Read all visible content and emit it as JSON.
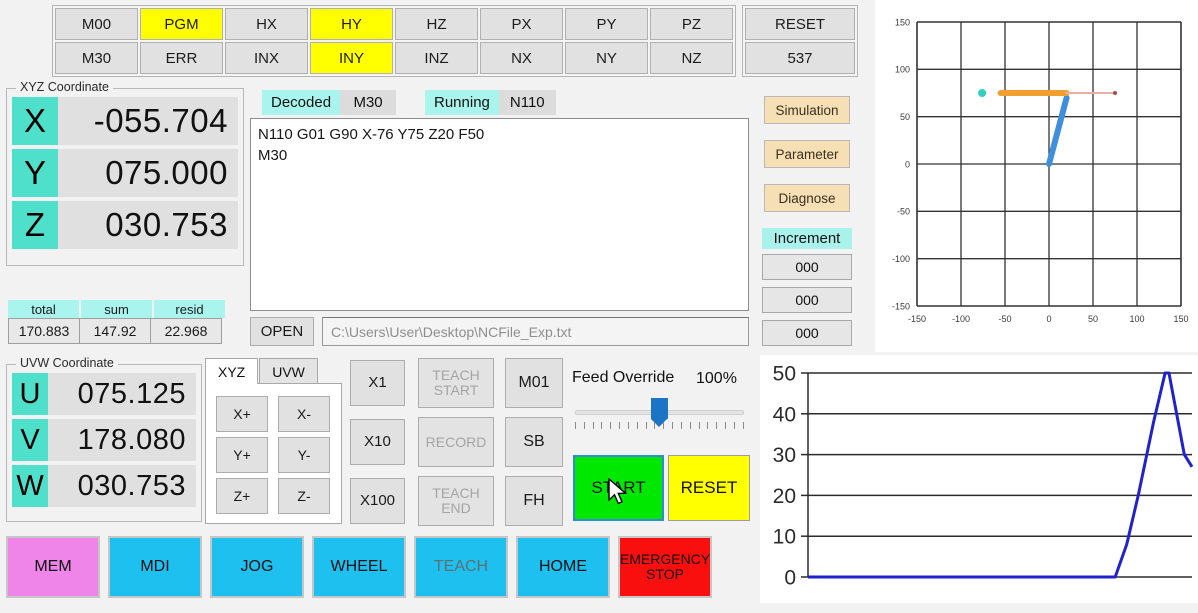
{
  "status_grid": {
    "row1": [
      "M00",
      "PGM",
      "HX",
      "HY",
      "HZ",
      "PX",
      "PY",
      "PZ"
    ],
    "row2": [
      "M30",
      "ERR",
      "INX",
      "INY",
      "INZ",
      "NX",
      "NY",
      "NZ"
    ],
    "active": [
      "PGM",
      "HY",
      "INY"
    ],
    "reset_label": "RESET",
    "counter": "537",
    "active_color": "#ffff00"
  },
  "xyz_panel": {
    "title": "XYZ Coordinate",
    "axes": [
      {
        "letter": "X",
        "value": "-055.704"
      },
      {
        "letter": "Y",
        "value": "075.000"
      },
      {
        "letter": "Z",
        "value": "030.753"
      }
    ],
    "letter_bg": "#4fe0cb"
  },
  "uvw_panel": {
    "title": "UVW Coordinate",
    "axes": [
      {
        "letter": "U",
        "value": "075.125"
      },
      {
        "letter": "V",
        "value": "178.080"
      },
      {
        "letter": "W",
        "value": "030.753"
      }
    ]
  },
  "totals": {
    "headers": [
      "total",
      "sum",
      "resid"
    ],
    "values": [
      "170.883",
      "147.92",
      "22.968"
    ]
  },
  "program": {
    "decoded_label": "Decoded",
    "decoded_value": "M30",
    "running_label": "Running",
    "running_value": "N110",
    "gcode": "N110 G01 G90 X-76 Y75 Z20 F50\nM30",
    "open_label": "OPEN",
    "file_path": "C:\\Users\\User\\Desktop\\NCFile_Exp.txt"
  },
  "side_actions": {
    "buttons": [
      "Simulation",
      "Parameter",
      "Diagnose"
    ],
    "increment_label": "Increment",
    "increment_values": [
      "000",
      "000",
      "000"
    ]
  },
  "jog": {
    "tabs": [
      "XYZ",
      "UVW"
    ],
    "active_tab": "XYZ",
    "buttons": [
      "X+",
      "X-",
      "Y+",
      "Y-",
      "Z+",
      "Z-"
    ]
  },
  "step_buttons": [
    "X1",
    "X10",
    "X100"
  ],
  "teach_buttons": [
    {
      "label": "TEACH\nSTART",
      "enabled": false
    },
    {
      "label": "RECORD",
      "enabled": false
    },
    {
      "label": "TEACH\nEND",
      "enabled": false
    }
  ],
  "aux_buttons": [
    "M01",
    "SB",
    "FH"
  ],
  "feed_override": {
    "label": "Feed Override",
    "percent": "100%",
    "slider_position": 50,
    "start_label": "START",
    "reset_label": "RESET",
    "start_color": "#00e800",
    "reset_color": "#ffff00"
  },
  "mode_bar": [
    {
      "label": "MEM",
      "style": "mem"
    },
    {
      "label": "MDI",
      "style": "cyan"
    },
    {
      "label": "JOG",
      "style": "cyan"
    },
    {
      "label": "WHEEL",
      "style": "cyan"
    },
    {
      "label": "TEACH",
      "style": "cyan-dim"
    },
    {
      "label": "HOME",
      "style": "cyan"
    },
    {
      "label": "EMERGENCY\nSTOP",
      "style": "red"
    }
  ],
  "chart_data": [
    {
      "type": "line",
      "name": "xy-toolpath-plot",
      "title": "",
      "xlabel": "",
      "ylabel": "",
      "xlim": [
        -150,
        150
      ],
      "ylim": [
        -150,
        150
      ],
      "xticks": [
        -150,
        -100,
        -50,
        0,
        50,
        100,
        150
      ],
      "yticks": [
        -150,
        -100,
        -50,
        0,
        50,
        100,
        150
      ],
      "grid": true,
      "series": [
        {
          "name": "completed-path-blue",
          "color": "#3f8fdd",
          "width": 6,
          "points": [
            [
              0,
              0
            ],
            [
              20,
              70
            ]
          ]
        },
        {
          "name": "current-path-orange",
          "color": "#f0a030",
          "width": 6,
          "points": [
            [
              20,
              75
            ],
            [
              -55,
              75
            ]
          ]
        },
        {
          "name": "pending-path-faded",
          "color": "#e8b0a8",
          "width": 2,
          "points": [
            [
              20,
              75
            ],
            [
              75,
              75
            ]
          ]
        }
      ],
      "markers": [
        {
          "name": "target-point",
          "color": "#2fd0c0",
          "x": -76,
          "y": 75,
          "size": 4
        },
        {
          "name": "endpoint-marker",
          "color": "#a05040",
          "x": 75,
          "y": 75,
          "size": 2
        }
      ]
    },
    {
      "type": "line",
      "name": "feed-rate-plot",
      "title": "",
      "xlabel": "",
      "ylabel": "",
      "xlim": [
        0,
        100
      ],
      "ylim": [
        0,
        50
      ],
      "yticks": [
        0,
        10,
        20,
        30,
        40,
        50
      ],
      "grid": true,
      "series": [
        {
          "name": "feed-rate",
          "color": "#2222cc",
          "width": 3,
          "points": [
            [
              0,
              0
            ],
            [
              80,
              0
            ],
            [
              83,
              8
            ],
            [
              86,
              20
            ],
            [
              90,
              38
            ],
            [
              93,
              50
            ],
            [
              94,
              50
            ],
            [
              96,
              40
            ],
            [
              98,
              30
            ],
            [
              100,
              27
            ]
          ]
        }
      ]
    }
  ]
}
